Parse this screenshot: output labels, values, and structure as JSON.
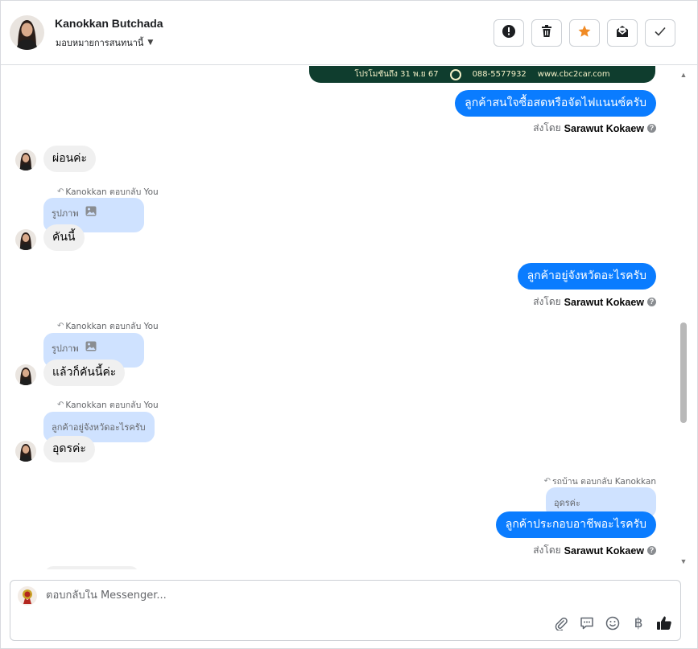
{
  "header": {
    "name": "Kanokkan Butchada",
    "assign_label": "มอบหมายการสนทนานี้",
    "actions": [
      {
        "name": "mark-spam-button",
        "icon": "exclamation-icon"
      },
      {
        "name": "delete-button",
        "icon": "trash-icon"
      },
      {
        "name": "star-button",
        "icon": "star-icon"
      },
      {
        "name": "mark-unread-button",
        "icon": "envelope-icon"
      },
      {
        "name": "mark-done-button",
        "icon": "check-icon"
      }
    ]
  },
  "banner": {
    "promo_text": "โปรโมชันถึง 31 พ.ย 67",
    "phone": "088-5577932",
    "website": "www.cbc2car.com"
  },
  "messages": {
    "out1": {
      "text": "ลูกค้าสนใจซื้อสดหรือจัดไฟแนนซ์ครับ",
      "sent_by_prefix": "ส่งโดย",
      "sender": "Sarawut Kokaew"
    },
    "in1": {
      "text": "ผ่อนค่ะ"
    },
    "reply1": {
      "label": "Kanokkan ตอบกลับ You",
      "quote": "รูปภาพ",
      "text": "คันนี้"
    },
    "out2": {
      "text": "ลูกค้าอยู่จังหวัดอะไรครับ",
      "sent_by_prefix": "ส่งโดย",
      "sender": "Sarawut Kokaew"
    },
    "reply2": {
      "label": "Kanokkan ตอบกลับ You",
      "quote": "รูปภาพ",
      "text": "แล้วก็คันนี้ค่ะ"
    },
    "reply3": {
      "label": "Kanokkan ตอบกลับ You",
      "quote": "ลูกค้าอยู่จังหวัดอะไรครับ",
      "text": "อุดรค่ะ"
    },
    "out3": {
      "label": "รถบ้าน ตอบกลับ Kanokkan",
      "quote": "อุดรค่ะ",
      "text": "ลูกค้าประกอบอาชีพอะไรครับ",
      "sent_by_prefix": "ส่งโดย",
      "sender": "Sarawut Kokaew"
    }
  },
  "composer": {
    "placeholder": "ตอบกลับใน Messenger...",
    "icons": [
      "paperclip-icon",
      "saved-reply-icon",
      "emoji-icon",
      "baht-icon",
      "thumbs-up-icon"
    ]
  },
  "colors": {
    "outgoing_bubble": "#0a7cff",
    "incoming_bubble": "#f0f0f0",
    "quote_bubble": "#cfe2ff",
    "star": "#f08a24"
  }
}
